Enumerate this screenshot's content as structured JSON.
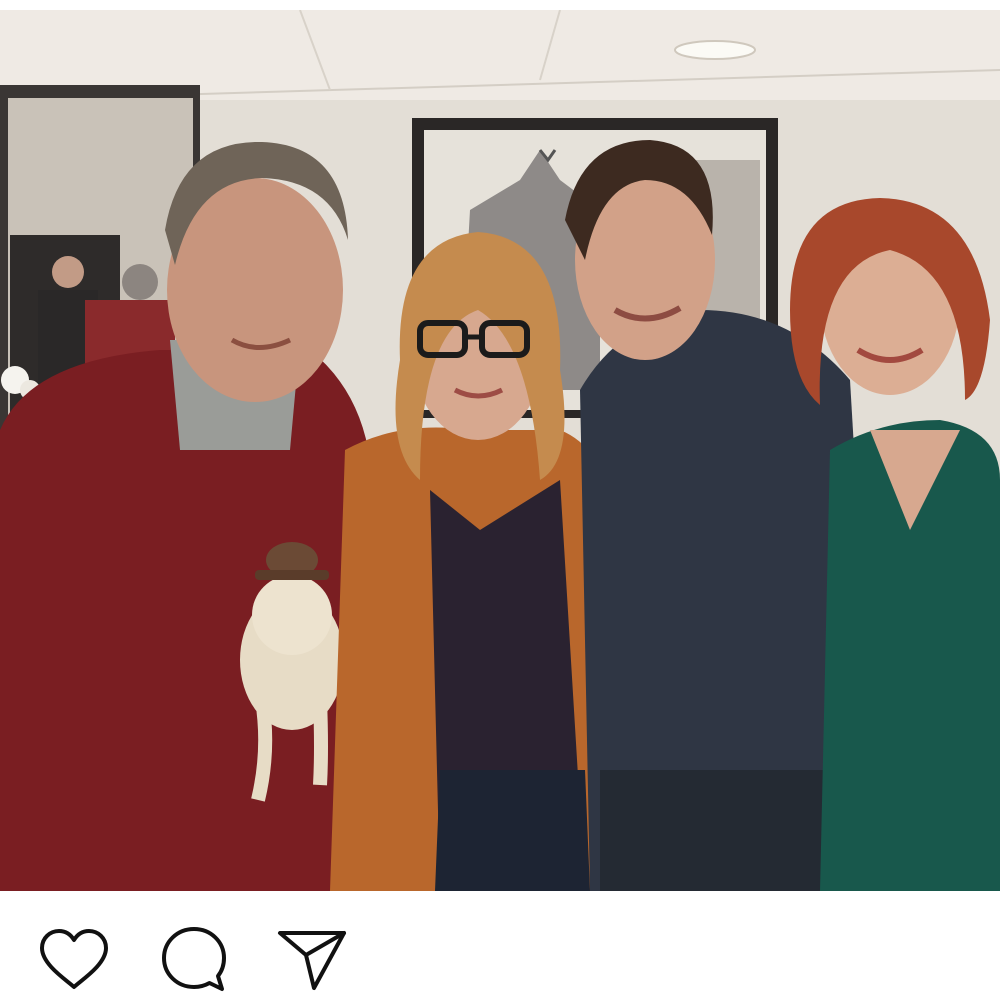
{
  "post": {
    "photo_alt": "",
    "actions": [
      {
        "id": "like",
        "icon": "heart-icon"
      },
      {
        "id": "comment",
        "icon": "speech-bubble-icon"
      },
      {
        "id": "share",
        "icon": "paper-plane-icon"
      }
    ]
  },
  "colors": {
    "icon_stroke": "#111111",
    "background": "#ffffff"
  }
}
